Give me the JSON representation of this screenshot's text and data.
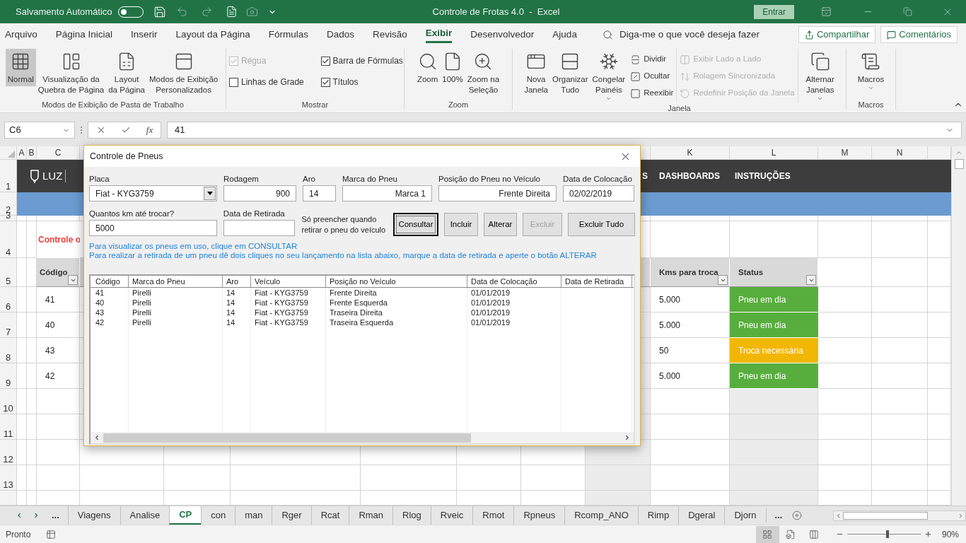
{
  "title_bar": {
    "autosave_label": "Salvamento Automático",
    "autosave_on": false,
    "title": "Controle de Frotas 4.0  -  Excel",
    "sign_in": "Entrar"
  },
  "menu_tabs": [
    {
      "label": "Arquivo",
      "selected": false
    },
    {
      "label": "Página Inicial",
      "selected": false
    },
    {
      "label": "Inserir",
      "selected": false
    },
    {
      "label": "Layout da Página",
      "selected": false
    },
    {
      "label": "Fórmulas",
      "selected": false
    },
    {
      "label": "Dados",
      "selected": false
    },
    {
      "label": "Revisão",
      "selected": false
    },
    {
      "label": "Exibir",
      "selected": true
    },
    {
      "label": "Desenvolvedor",
      "selected": false
    },
    {
      "label": "Ajuda",
      "selected": false
    }
  ],
  "tell_me": "Diga-me o que você deseja fazer",
  "share": "Compartilhar",
  "comments": "Comentários",
  "ribbon_groups": [
    {
      "label": "Modos de Exibição de Pasta de Trabalho",
      "items": [
        {
          "kind": "large",
          "label": "Normal",
          "selected": true
        },
        {
          "kind": "large",
          "label": "Visualização da\nQuebra de Página",
          "selected": false
        },
        {
          "kind": "large",
          "label": "Layout\nda Página",
          "selected": false
        },
        {
          "kind": "large",
          "label": "Modos de Exibição\nPersonalizados",
          "selected": false
        }
      ]
    },
    {
      "label": "Mostrar",
      "items": [
        {
          "kind": "check",
          "label": "Régua",
          "checked": true,
          "disabled": true
        },
        {
          "kind": "check",
          "label": "Barra de Fórmulas",
          "checked": true,
          "disabled": false
        },
        {
          "kind": "check",
          "label": "Linhas de Grade",
          "checked": false,
          "disabled": false
        },
        {
          "kind": "check",
          "label": "Títulos",
          "checked": true,
          "disabled": false
        }
      ]
    },
    {
      "label": "Zoom",
      "items": [
        {
          "kind": "large",
          "label": "Zoom",
          "dropdown": false
        },
        {
          "kind": "large",
          "label": "100%",
          "dropdown": false
        },
        {
          "kind": "large",
          "label": "Zoom na\nSeleção",
          "dropdown": false
        }
      ]
    },
    {
      "label": "Janela",
      "items": [
        {
          "kind": "large",
          "label": "Nova\nJanela",
          "dropdown": false
        },
        {
          "kind": "large",
          "label": "Organizar\nTudo",
          "dropdown": false
        },
        {
          "kind": "large",
          "label": "Congelar\nPainéis",
          "dropdown": true
        },
        {
          "kind": "small",
          "label": "Dividir",
          "disabled": false
        },
        {
          "kind": "small",
          "label": "Ocultar",
          "disabled": false
        },
        {
          "kind": "small",
          "label": "Reexibir",
          "disabled": false
        },
        {
          "kind": "small",
          "label": "Exibir Lado a Lado",
          "disabled": true
        },
        {
          "kind": "small",
          "label": "Rolagem Sincronizada",
          "disabled": true
        },
        {
          "kind": "small",
          "label": "Redefinir Posição da Janela",
          "disabled": true
        },
        {
          "kind": "large",
          "label": "Alternar\nJanelas",
          "dropdown": true
        }
      ]
    },
    {
      "label": "Macros",
      "items": [
        {
          "kind": "large",
          "label": "Macros",
          "dropdown": true
        }
      ]
    }
  ],
  "formula_bar": {
    "name_box": "C6",
    "function_label": "fx",
    "value": "41"
  },
  "sheet": {
    "column_letters": [
      "A",
      "B",
      "C",
      "K",
      "L",
      "M",
      "N"
    ],
    "row_numbers": [
      "1",
      "2",
      "3",
      "4",
      "5",
      "6",
      "7",
      "8",
      "9",
      "10",
      "11",
      "12",
      "13"
    ],
    "logo_text": "LUZ",
    "nav": [
      "S",
      "DASHBOARDS",
      "INSTRUÇÕES"
    ],
    "heading": "Controle o",
    "headers": [
      "Código",
      "Kms para troca",
      "Status"
    ],
    "rows": [
      {
        "code": "41",
        "kms": "5.000",
        "status": "Pneu em dia",
        "color": "#58ae3d"
      },
      {
        "code": "40",
        "kms": "5.000",
        "status": "Pneu em dia",
        "color": "#58ae3d"
      },
      {
        "code": "43",
        "kms": "50",
        "status": "Troca necessária",
        "color": "#f2b705"
      },
      {
        "code": "42",
        "kms": "5.000",
        "status": "Pneu em dia",
        "color": "#58ae3d"
      }
    ]
  },
  "dialog": {
    "title": "Controle de Pneus",
    "fields_row1": [
      {
        "kind": "combo",
        "label": "Placa",
        "value": "Fiat - KYG3759"
      },
      {
        "kind": "text",
        "label": "Rodagem",
        "value": "900"
      },
      {
        "kind": "text",
        "label": "Aro",
        "value": "14"
      },
      {
        "kind": "text",
        "label": "Marca do Pneu",
        "value": "Marca 1"
      },
      {
        "kind": "text",
        "label": "Posição do Pneu no Veículo",
        "value": "Frente Direita"
      },
      {
        "kind": "text",
        "label": "Data de Colocação",
        "value": "02/02/2019"
      }
    ],
    "fields_row2": [
      {
        "kind": "text",
        "label": "Quantos km até trocar?",
        "value": "5000"
      },
      {
        "kind": "text",
        "label": "Data de Retirada"
      }
    ],
    "note": "Só preencher quando\nretirar o pneu do veículo",
    "buttons": [
      {
        "label": "Consultar",
        "focused": true,
        "disabled": false
      },
      {
        "label": "Incluir",
        "focused": false,
        "disabled": false
      },
      {
        "label": "Alterar",
        "focused": false,
        "disabled": false
      },
      {
        "label": "Excluir",
        "focused": false,
        "disabled": true
      },
      {
        "label": "Excluir Tudo",
        "focused": false,
        "disabled": false
      }
    ],
    "info": [
      "Para visualizar os pneus em uso, clique em CONSULTAR",
      "Para realizar a retirada de um pneu dê dois cliques no seu lançamento na lista abaixo, marque a data de retirada e aperte o botão ALTERAR"
    ],
    "list_columns": [
      "Código",
      "Marca do Pneu",
      "Aro",
      "Veículo",
      "Posição no Veículo",
      "Data de Colocação",
      "Data de Retirada"
    ],
    "list_rows": [
      [
        "41",
        "Pirelli",
        "14",
        "Fiat - KYG3759",
        "Frente Direita",
        "01/01/2019"
      ],
      [
        "40",
        "Pirelli",
        "14",
        "Fiat - KYG3759",
        "Frente Esquerda",
        "01/01/2019"
      ],
      [
        "43",
        "Pirelli",
        "14",
        "Fiat - KYG3759",
        "Traseira Direita",
        "01/01/2019"
      ],
      [
        "42",
        "Pirelli",
        "14",
        "Fiat - KYG3759",
        "Traseira Esquerda",
        "01/01/2019"
      ]
    ]
  },
  "sheet_tabs": {
    "more_left": "...",
    "more_right": "...",
    "tabs": [
      {
        "label": "Viagens",
        "selected": false
      },
      {
        "label": "Analise",
        "selected": false
      },
      {
        "label": "CP",
        "selected": true
      },
      {
        "label": "con",
        "selected": false
      },
      {
        "label": "man",
        "selected": false
      },
      {
        "label": "Rger",
        "selected": false
      },
      {
        "label": "Rcat",
        "selected": false
      },
      {
        "label": "Rman",
        "selected": false
      },
      {
        "label": "Rlog",
        "selected": false
      },
      {
        "label": "Rveic",
        "selected": false
      },
      {
        "label": "Rmot",
        "selected": false
      },
      {
        "label": "Rpneus",
        "selected": false
      },
      {
        "label": "Rcomp_ANO",
        "selected": false
      },
      {
        "label": "Rimp",
        "selected": false
      },
      {
        "label": "Dgeral",
        "selected": false
      },
      {
        "label": "Djorn",
        "selected": false
      }
    ]
  },
  "status_bar": {
    "status": "Pronto",
    "views": [
      {
        "selected": true
      },
      {
        "selected": false
      },
      {
        "selected": false
      }
    ],
    "zoom": {
      "level": 0.55,
      "label": "90%"
    }
  }
}
